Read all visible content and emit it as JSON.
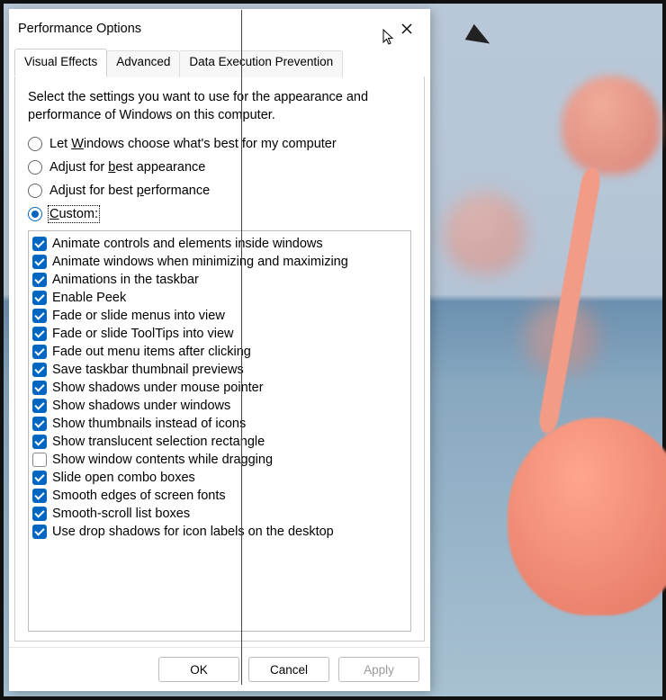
{
  "window": {
    "title": "Performance Options",
    "close": "✕"
  },
  "tabs": [
    {
      "label": "Visual Effects",
      "active": true
    },
    {
      "label": "Advanced",
      "active": false
    },
    {
      "label": "Data Execution Prevention",
      "active": false
    }
  ],
  "intro": "Select the settings you want to use for the appearance and performance of Windows on this computer.",
  "radios": [
    {
      "id": "opt-let",
      "label_pre": "Let ",
      "access": "W",
      "label_post": "indows choose what's best for my computer",
      "checked": false
    },
    {
      "id": "opt-best-app",
      "label_pre": "Adjust for ",
      "access": "b",
      "label_post": "est appearance",
      "checked": false
    },
    {
      "id": "opt-best-perf",
      "label_pre": "Adjust for best ",
      "access": "p",
      "label_post": "erformance",
      "checked": false
    },
    {
      "id": "opt-custom",
      "label_pre": "",
      "access": "C",
      "label_post": "ustom:",
      "checked": true
    }
  ],
  "effects": [
    {
      "label": "Animate controls and elements inside windows",
      "checked": true
    },
    {
      "label": "Animate windows when minimizing and maximizing",
      "checked": true
    },
    {
      "label": "Animations in the taskbar",
      "checked": true
    },
    {
      "label": "Enable Peek",
      "checked": true
    },
    {
      "label": "Fade or slide menus into view",
      "checked": true
    },
    {
      "label": "Fade or slide ToolTips into view",
      "checked": true
    },
    {
      "label": "Fade out menu items after clicking",
      "checked": true
    },
    {
      "label": "Save taskbar thumbnail previews",
      "checked": true
    },
    {
      "label": "Show shadows under mouse pointer",
      "checked": true
    },
    {
      "label": "Show shadows under windows",
      "checked": true
    },
    {
      "label": "Show thumbnails instead of icons",
      "checked": true
    },
    {
      "label": "Show translucent selection rectangle",
      "checked": true
    },
    {
      "label": "Show window contents while dragging",
      "checked": false
    },
    {
      "label": "Slide open combo boxes",
      "checked": true
    },
    {
      "label": "Smooth edges of screen fonts",
      "checked": true
    },
    {
      "label": "Smooth-scroll list boxes",
      "checked": true
    },
    {
      "label": "Use drop shadows for icon labels on the desktop",
      "checked": true
    }
  ],
  "buttons": {
    "ok": "OK",
    "cancel": "Cancel",
    "apply": "Apply"
  }
}
